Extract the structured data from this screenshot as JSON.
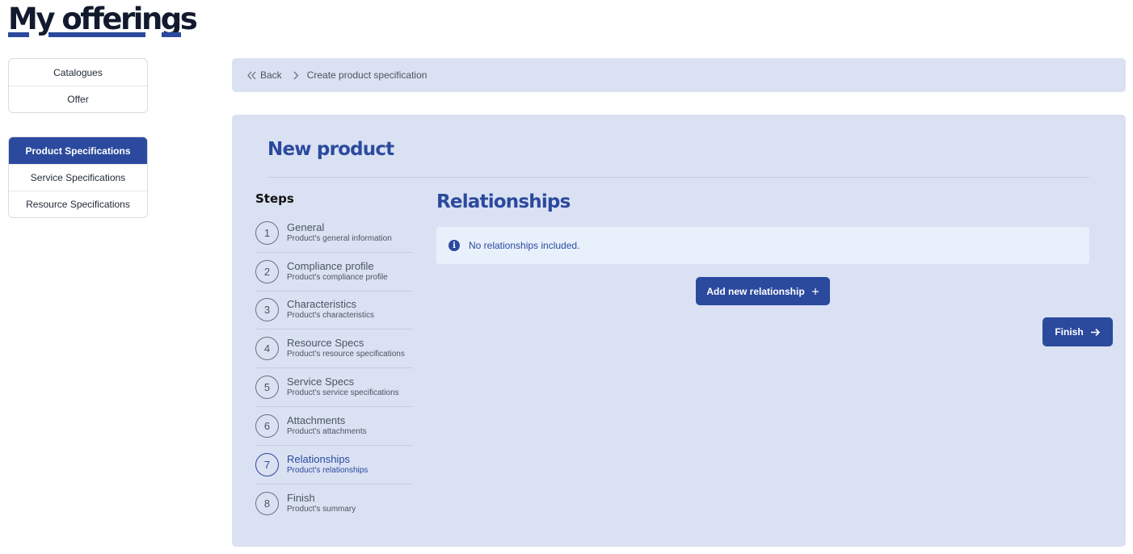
{
  "page": {
    "title": "My offerings"
  },
  "sidebar": {
    "group1": [
      {
        "label": "Catalogues",
        "active": false
      },
      {
        "label": "Offer",
        "active": false
      }
    ],
    "group2": [
      {
        "label": "Product Specifications",
        "active": true
      },
      {
        "label": "Service Specifications",
        "active": false
      },
      {
        "label": "Resource Specifications",
        "active": false
      }
    ]
  },
  "breadcrumb": {
    "back_label": "Back",
    "current": "Create product specification"
  },
  "form": {
    "title": "New product",
    "steps_title": "Steps",
    "steps": [
      {
        "number": "1",
        "name": "General",
        "desc": "Product's general information"
      },
      {
        "number": "2",
        "name": "Compliance profile",
        "desc": "Product's compliance profile"
      },
      {
        "number": "3",
        "name": "Characteristics",
        "desc": "Product's characteristics"
      },
      {
        "number": "4",
        "name": "Resource Specs",
        "desc": "Product's resource specifications"
      },
      {
        "number": "5",
        "name": "Service Specs",
        "desc": "Product's service specifications"
      },
      {
        "number": "6",
        "name": "Attachments",
        "desc": "Product's attachments"
      },
      {
        "number": "7",
        "name": "Relationships",
        "desc": "Product's relationships"
      },
      {
        "number": "8",
        "name": "Finish",
        "desc": "Product's summary"
      }
    ],
    "active_step": 7,
    "section_title": "Relationships",
    "info_text": "No relationships included.",
    "add_button_label": "Add new relationship",
    "finish_button_label": "Finish"
  },
  "colors": {
    "primary": "#2b4a9e",
    "panel_bg": "#dae1f2",
    "info_bg": "#e8f0fc",
    "title_text": "#121a2e"
  },
  "icons": {
    "back": "double-chevron-left-icon",
    "separator": "chevron-right-icon",
    "info": "info-circle-icon",
    "add": "plus-icon",
    "finish": "arrow-right-icon"
  }
}
